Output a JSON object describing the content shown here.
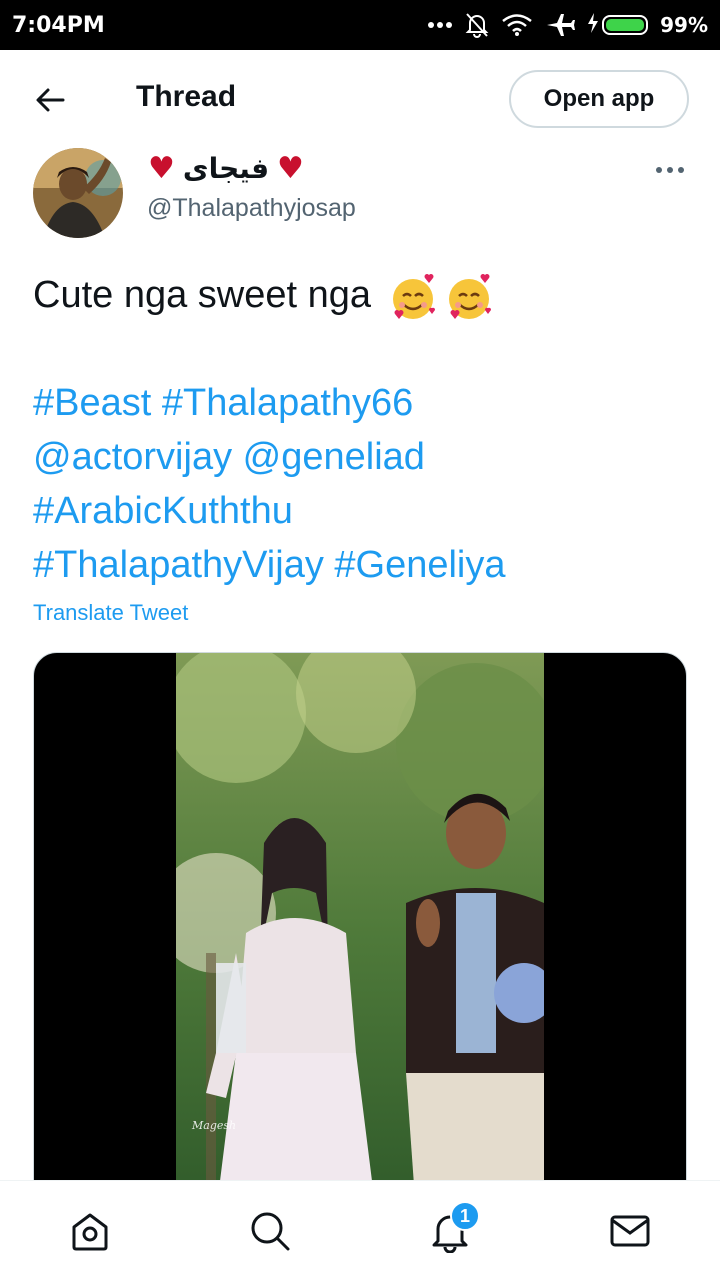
{
  "status_bar": {
    "time": "7:04PM",
    "battery_percent": "99%",
    "battery_level": 0.99,
    "icons": [
      "more-dots-icon",
      "mute-bell-icon",
      "wifi-icon",
      "airplane-icon",
      "charging-bolt-icon",
      "battery-icon"
    ]
  },
  "header": {
    "title": "Thread",
    "open_app_label": "Open app"
  },
  "tweet": {
    "display_name": "فيجاى",
    "handle": "@Thalapathyjosap",
    "text": "Cute nga sweet nga",
    "hashtags_lines": [
      [
        "#Beast",
        "#Thalapathy66"
      ],
      [
        "@actorvijay",
        "@geneliad"
      ],
      [
        "#ArabicKuththu"
      ],
      [
        "#ThalapathyVijay",
        "#Geneliya"
      ]
    ],
    "translate_label": "Translate Tweet",
    "video_watermark": "Magesh"
  },
  "bottom_nav": {
    "notification_count": "1",
    "items": [
      "home-icon",
      "search-icon",
      "notifications-icon",
      "messages-icon"
    ]
  },
  "colors": {
    "accent": "#1d9bf0",
    "heart": "#c8102e",
    "battery": "#3ed34a"
  }
}
